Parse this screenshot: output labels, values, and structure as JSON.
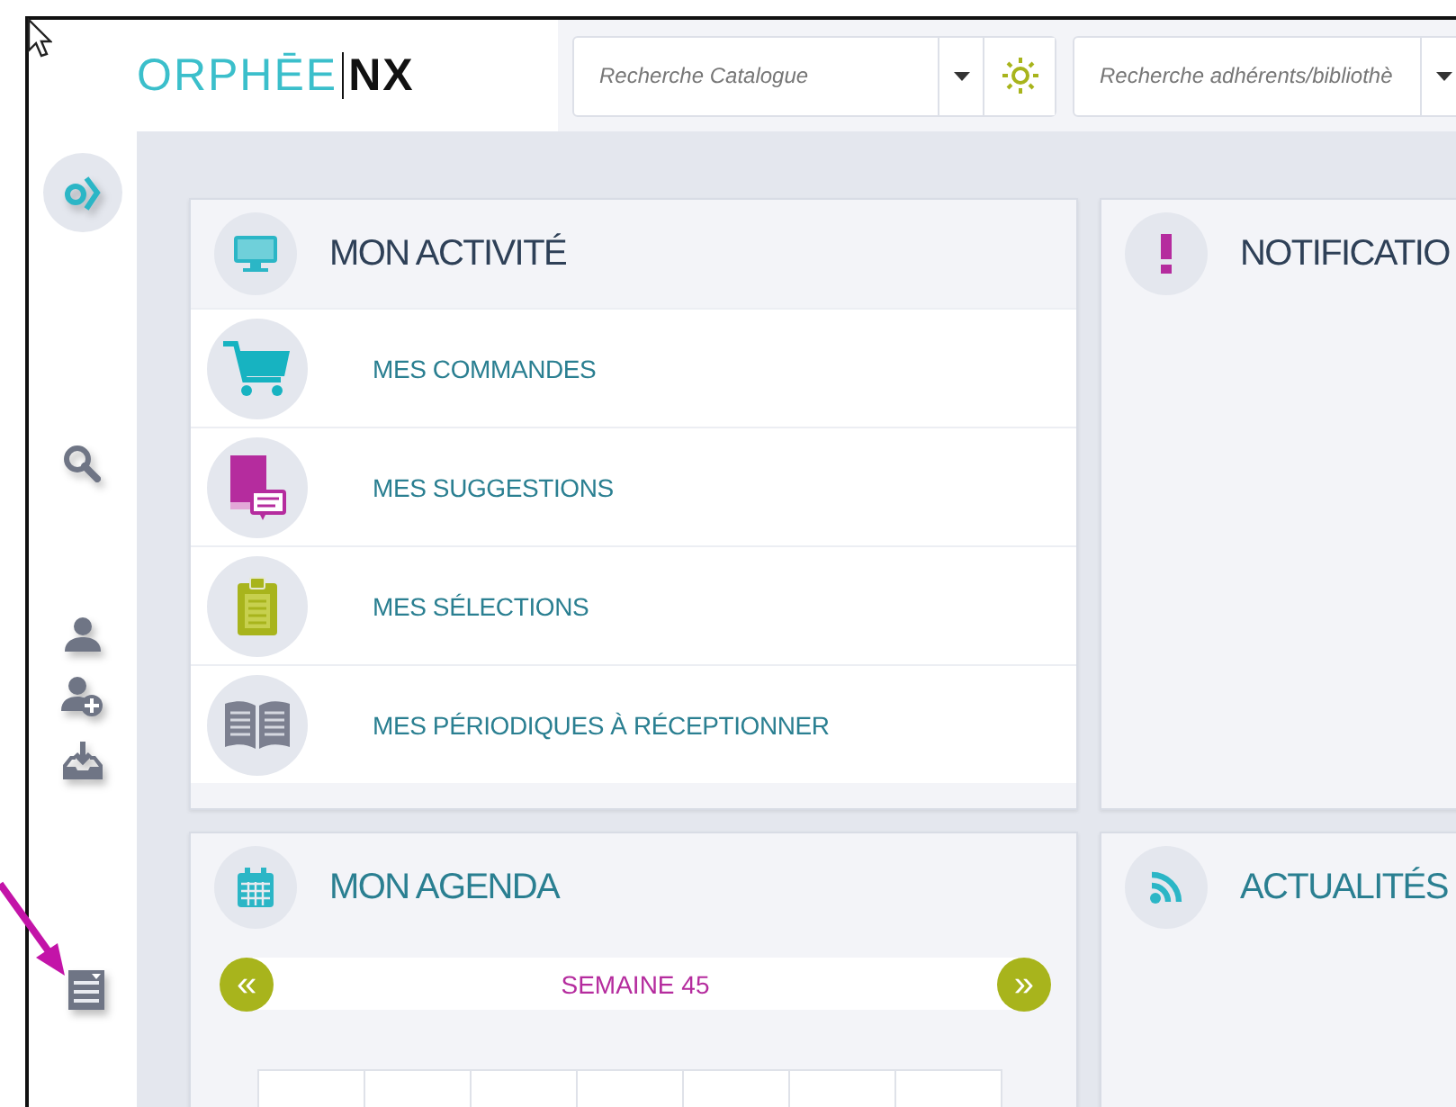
{
  "header": {
    "logo": {
      "brand": "ORPHĒE",
      "suffix": "NX"
    },
    "searches": [
      {
        "placeholder": "Recherche Catalogue",
        "action": true
      },
      {
        "placeholder": "Recherche adhérents/bibliothè",
        "action": false
      }
    ]
  },
  "panels": [
    {
      "kind": "activity",
      "title": "MON ACTIVITÉ",
      "items": [
        {
          "label": "MES COMMANDES"
        },
        {
          "label": "MES SUGGESTIONS"
        },
        {
          "label": "MES SÉLECTIONS"
        },
        {
          "label": "MES PÉRIODIQUES À RÉCEPTIONNER"
        }
      ]
    },
    {
      "kind": "notifications",
      "title": "NOTIFICATIO"
    },
    {
      "kind": "agenda",
      "title": "MON AGENDA",
      "week": {
        "prev": "«",
        "label": "SEMAINE 45",
        "next": "»"
      }
    },
    {
      "kind": "news",
      "title": "ACTUALITÉS"
    }
  ]
}
